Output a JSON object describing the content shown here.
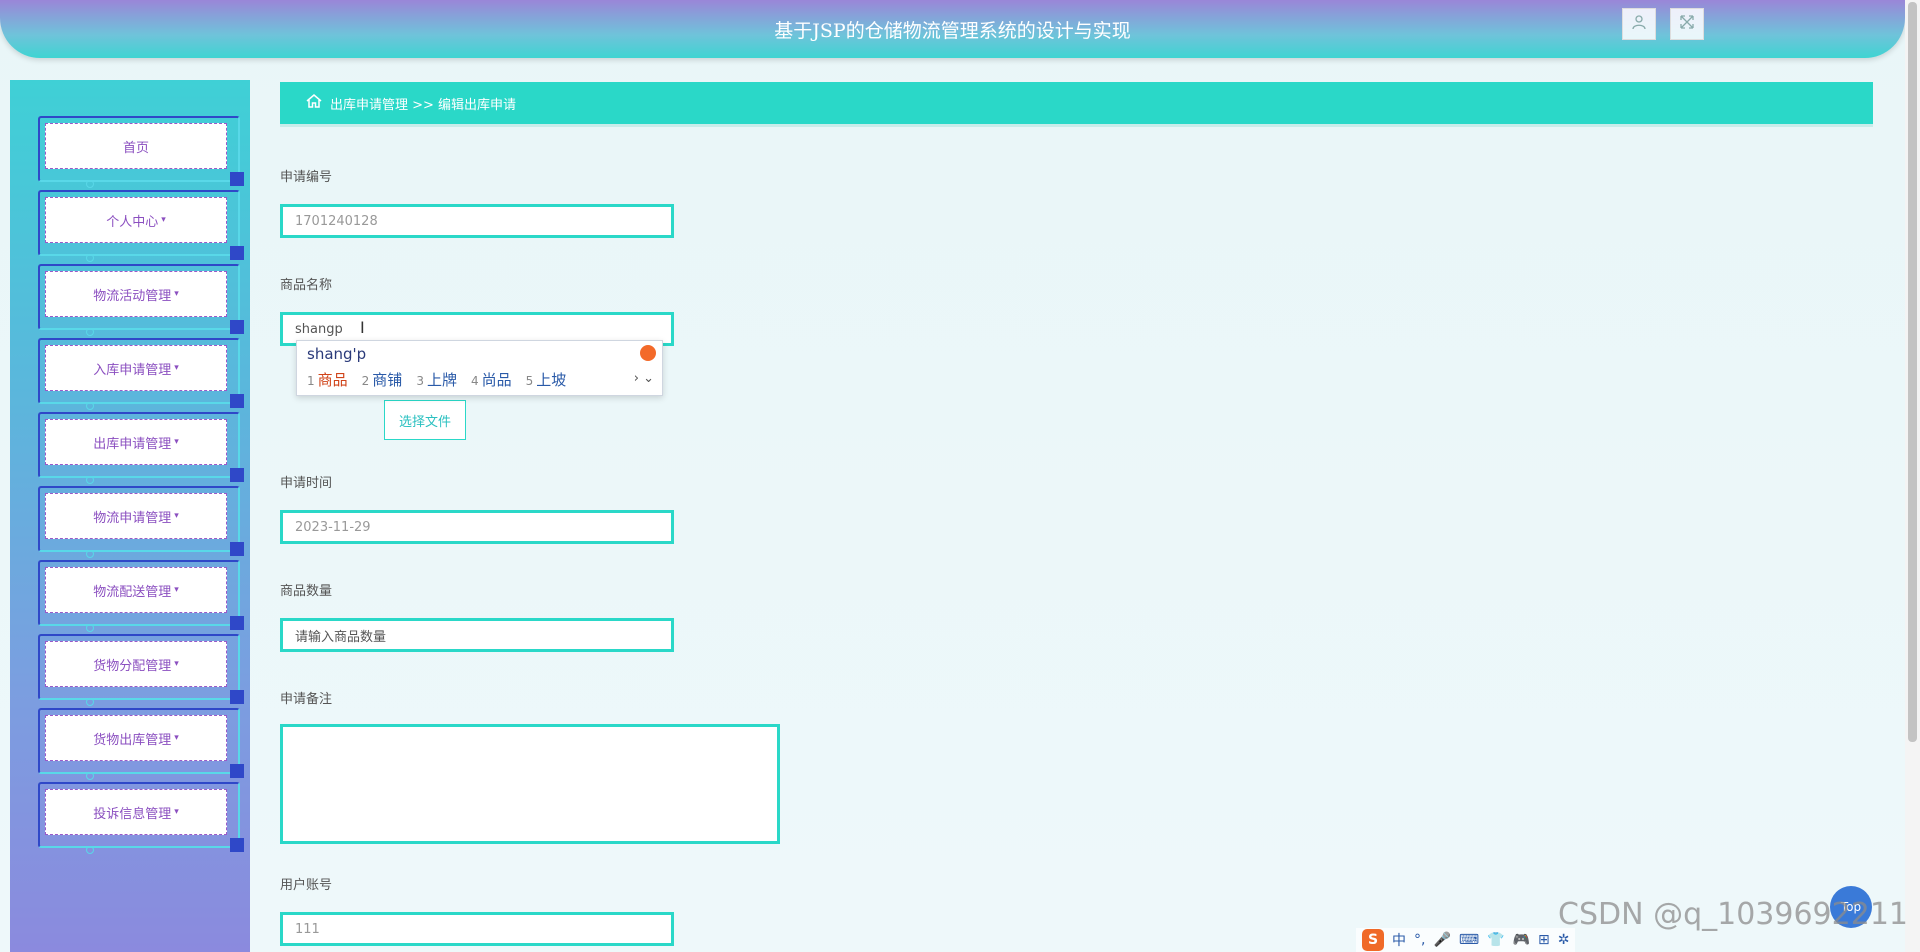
{
  "header": {
    "title": "基于JSP的仓储物流管理系统的设计与实现",
    "user_icon": "user-icon",
    "fullscreen_icon": "fullscreen-icon"
  },
  "sidebar": {
    "items": [
      {
        "label": "首页",
        "has_caret": false
      },
      {
        "label": "个人中心",
        "has_caret": true
      },
      {
        "label": "物流活动管理",
        "has_caret": true
      },
      {
        "label": "入库申请管理",
        "has_caret": true
      },
      {
        "label": "出库申请管理",
        "has_caret": true
      },
      {
        "label": "物流申请管理",
        "has_caret": true
      },
      {
        "label": "物流配送管理",
        "has_caret": true
      },
      {
        "label": "货物分配管理",
        "has_caret": true
      },
      {
        "label": "货物出库管理",
        "has_caret": true
      },
      {
        "label": "投诉信息管理",
        "has_caret": true
      }
    ],
    "caret": "▾"
  },
  "breadcrumb": {
    "home_icon": "home-icon",
    "text": "出库申请管理 >> 编辑出库申请"
  },
  "form": {
    "apply_no": {
      "label": "申请编号",
      "value": "1701240128"
    },
    "product_name": {
      "label": "商品名称",
      "value": "shangp"
    },
    "file_button": "选择文件",
    "apply_time": {
      "label": "申请时间",
      "value": "2023-11-29"
    },
    "quantity": {
      "label": "商品数量",
      "placeholder": "请输入商品数量"
    },
    "remark": {
      "label": "申请备注",
      "value": ""
    },
    "user_account": {
      "label": "用户账号",
      "value": "111"
    }
  },
  "ime": {
    "composition": "shang'p",
    "candidates": [
      {
        "num": "1",
        "text": "商品"
      },
      {
        "num": "2",
        "text": "商铺"
      },
      {
        "num": "3",
        "text": "上牌"
      },
      {
        "num": "4",
        "text": "尚品"
      },
      {
        "num": "5",
        "text": "上坡"
      }
    ],
    "nav": "› ⌄",
    "toolbar": {
      "logo": "S",
      "items": [
        "中",
        "°,",
        "🎤",
        "⌨",
        "👕",
        "🎮",
        "⊞",
        "✲"
      ]
    }
  },
  "footer": {
    "watermark": "CSDN @q_1039692211",
    "top_button": "Top"
  },
  "colors": {
    "accent": "#2ad8c8",
    "menu_text": "#8b4fc0",
    "menu_border": "#2f48c8"
  }
}
